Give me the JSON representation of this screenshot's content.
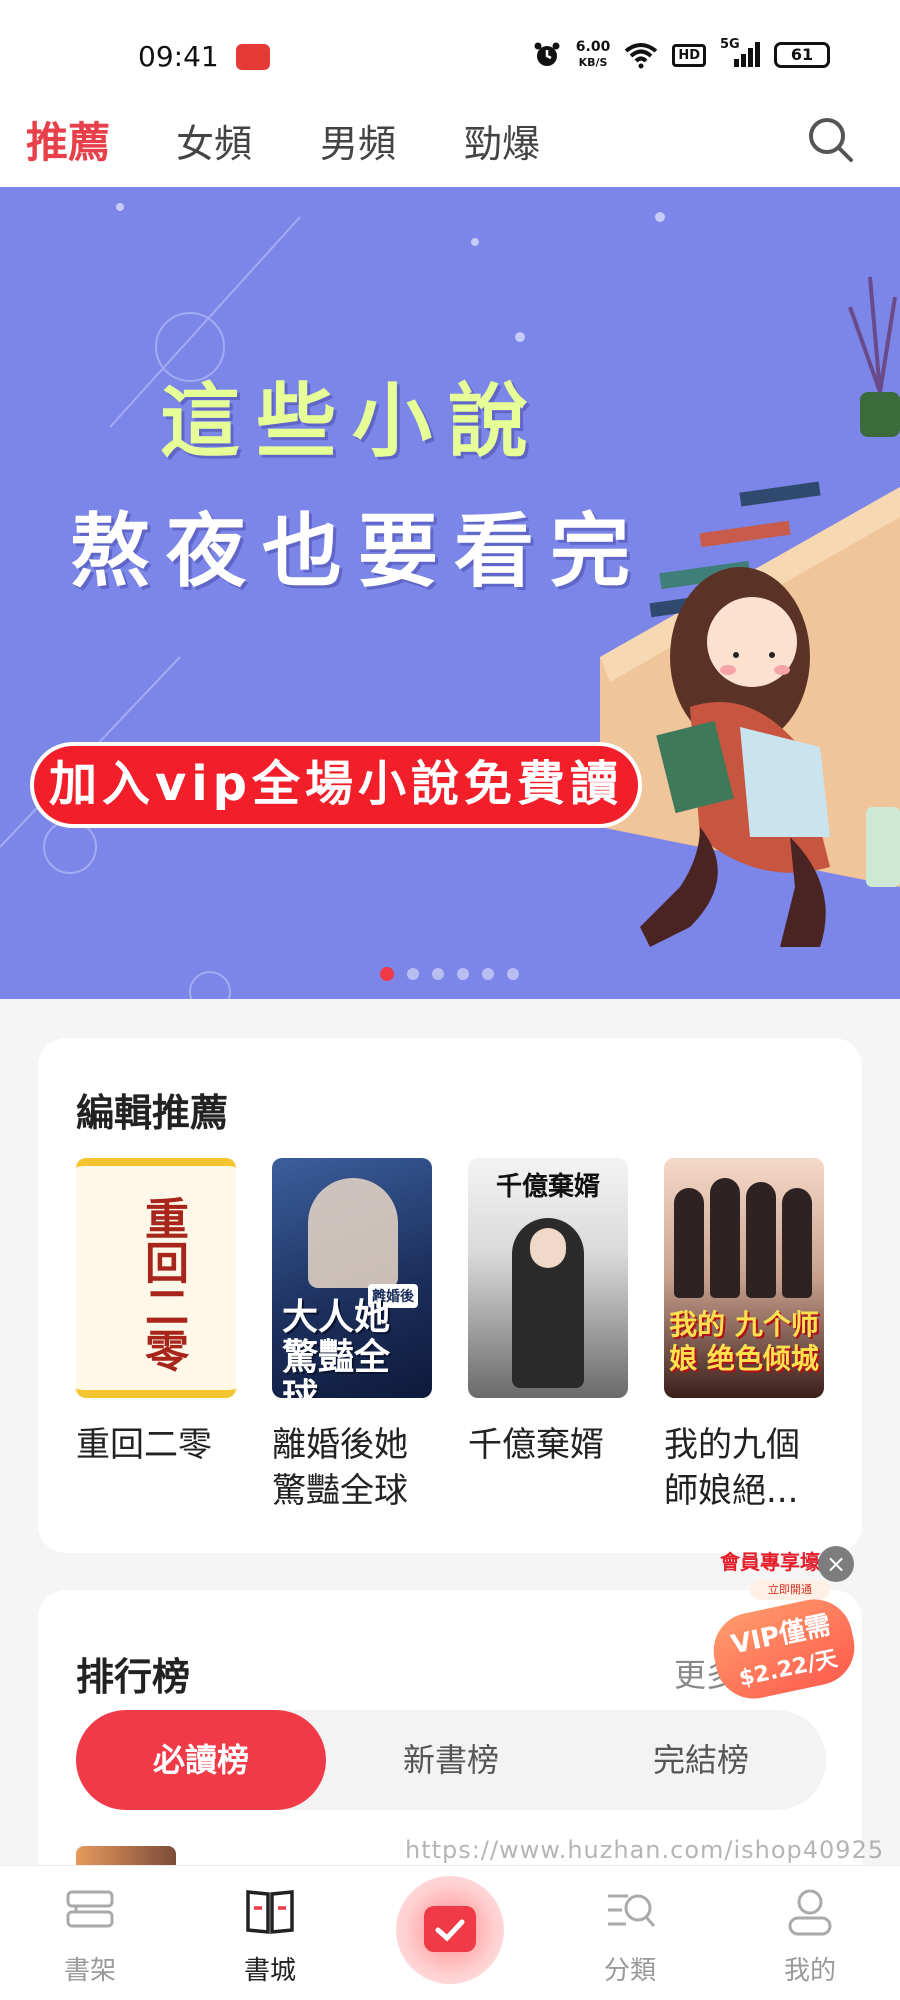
{
  "status_bar": {
    "time": "09:41",
    "net_speed_value": "6.00",
    "net_speed_unit": "KB/S",
    "hd_label": "HD",
    "signal_label": "5G",
    "battery": "61",
    "icons": [
      "alarm-icon",
      "wifi-icon",
      "signal-icon",
      "battery-icon"
    ]
  },
  "top_tabs": {
    "items": [
      {
        "label": "推薦",
        "active": true
      },
      {
        "label": "女頻",
        "active": false
      },
      {
        "label": "男頻",
        "active": false
      },
      {
        "label": "勁爆",
        "active": false
      }
    ],
    "search_icon": "search-icon"
  },
  "banner": {
    "line1": "這些小說",
    "line2": "熬夜也要看完",
    "cta": "加入vip全場小說免費讀",
    "dot_count": 6,
    "active_dot": 0
  },
  "editor_picks": {
    "title": "編輯推薦",
    "books": [
      {
        "title": "重回二零",
        "cover_text": "重回二零"
      },
      {
        "title": "離婚後她驚豔全球",
        "cover_text": "大人她 驚豔全球",
        "cover_tag": "離婚後"
      },
      {
        "title": "千億棄婿",
        "cover_text": "千億棄婿"
      },
      {
        "title": "我的九個師娘絕...",
        "cover_text": "我的 九个师娘 绝色倾城"
      }
    ]
  },
  "ranking": {
    "title": "排行榜",
    "more": "更多",
    "tabs": [
      {
        "label": "必讀榜",
        "active": true
      },
      {
        "label": "新書榜",
        "active": false
      },
      {
        "label": "完結榜",
        "active": false
      }
    ]
  },
  "promo": {
    "title": "會員專享壕禮",
    "subtitle": "立即開通",
    "line1": "VIP僅需",
    "line2": "$2.22/天",
    "close": "×"
  },
  "watermark": "https://www.huzhan.com/ishop40925",
  "bottom_nav": {
    "items": [
      {
        "label": "書架",
        "icon": "bookshelf-icon",
        "active": false
      },
      {
        "label": "書城",
        "icon": "open-book-icon",
        "active": true
      },
      {
        "label": "",
        "icon": "checkin-icon",
        "active": false
      },
      {
        "label": "分類",
        "icon": "category-icon",
        "active": false
      },
      {
        "label": "我的",
        "icon": "profile-icon",
        "active": false
      }
    ]
  },
  "colors": {
    "accent": "#f03a47",
    "banner_bg": "#7b86e8",
    "tab_active": "#e8404a"
  }
}
